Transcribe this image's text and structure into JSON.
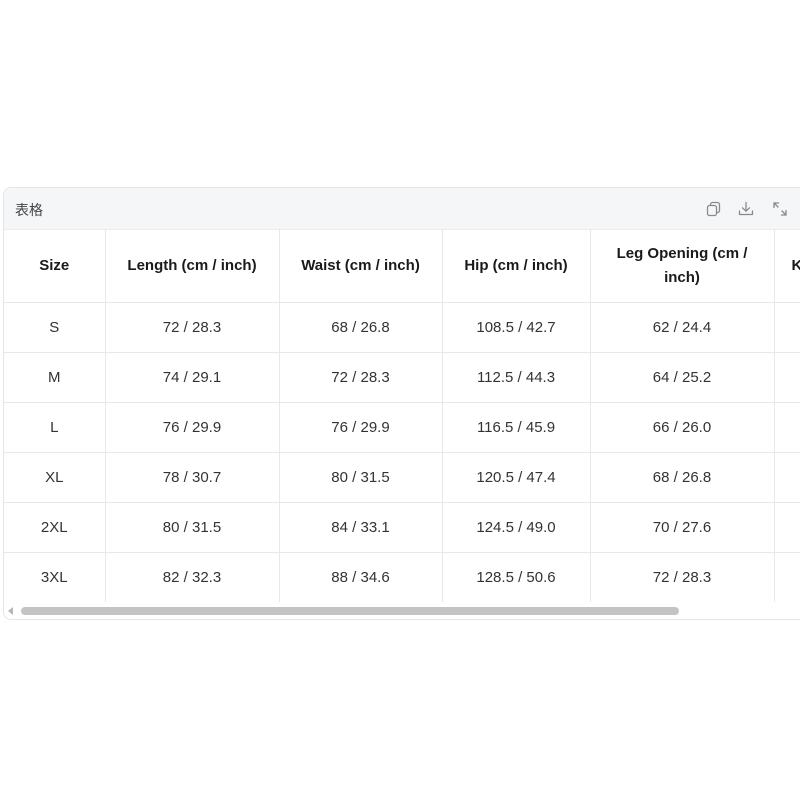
{
  "card": {
    "title": "表格"
  },
  "toolbar": {
    "copy_icon": "copy-icon",
    "download_icon": "download-icon",
    "expand_icon": "expand-icon"
  },
  "table": {
    "headers": [
      "Size",
      "Length (cm / inch)",
      "Waist (cm / inch)",
      "Hip (cm / inch)",
      "Leg Opening (cm / inch)",
      "K"
    ],
    "rows": [
      [
        "S",
        "72 / 28.3",
        "68 / 26.8",
        "108.5 / 42.7",
        "62 / 24.4",
        ""
      ],
      [
        "M",
        "74 / 29.1",
        "72 / 28.3",
        "112.5 / 44.3",
        "64 / 25.2",
        ""
      ],
      [
        "L",
        "76 / 29.9",
        "76 / 29.9",
        "116.5 / 45.9",
        "66 / 26.0",
        ""
      ],
      [
        "XL",
        "78 / 30.7",
        "80 / 31.5",
        "120.5 / 47.4",
        "68 / 26.8",
        ""
      ],
      [
        "2XL",
        "80 / 31.5",
        "84 / 33.1",
        "124.5 / 49.0",
        "70 / 27.6",
        ""
      ],
      [
        "3XL",
        "82 / 32.3",
        "88 / 34.6",
        "128.5 / 50.6",
        "72 / 28.3",
        ""
      ]
    ]
  },
  "colors": {
    "header_bg": "#f5f6f7",
    "border": "#e8e8e8",
    "scroll_thumb": "#c4c4c4"
  }
}
